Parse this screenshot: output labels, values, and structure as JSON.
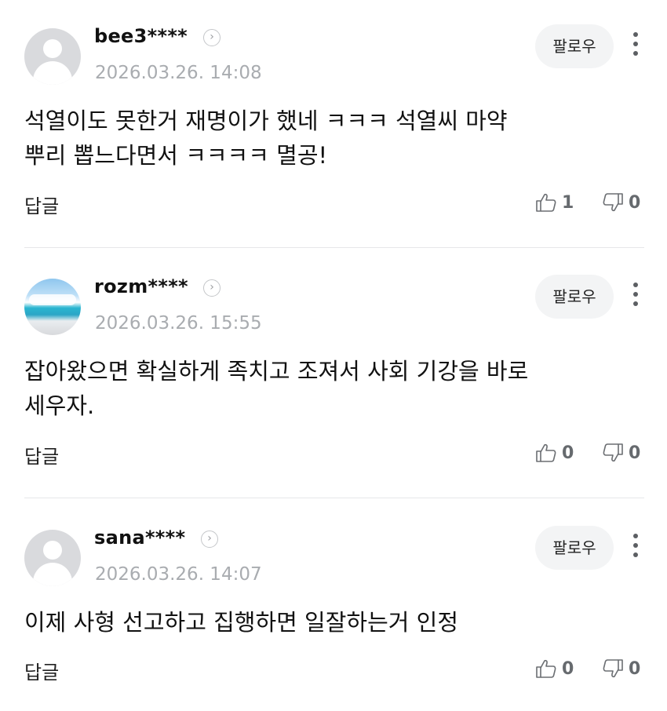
{
  "comments": [
    {
      "username": "bee3****",
      "timestamp": "2026.03.26. 14:08",
      "follow_label": "팔로우",
      "body_lines": [
        "석열이도 못한거 재명이가 했네 ㅋㅋㅋ 석열씨 마약",
        "뿌리 뽑느다면서 ㅋㅋㅋㅋ 멸공!"
      ],
      "reply_label": "답글",
      "likes": "1",
      "dislikes": "0",
      "avatar": "default-avatar"
    },
    {
      "username": "rozm****",
      "timestamp": "2026.03.26. 15:55",
      "follow_label": "팔로우",
      "body_lines": [
        "잡아왔으면 확실하게 족치고 조져서 사회 기강을 바로",
        "세우자."
      ],
      "reply_label": "답글",
      "likes": "0",
      "dislikes": "0",
      "avatar": "beach-photo-avatar"
    },
    {
      "username": "sana****",
      "timestamp": "2026.03.26. 14:07",
      "follow_label": "팔로우",
      "body_lines": [
        "이제 사형 선고하고 집행하면 일잘하는거 인정"
      ],
      "reply_label": "답글",
      "likes": "0",
      "dislikes": "0",
      "avatar": "default-avatar"
    }
  ],
  "icons": {
    "profile_chevron": "chevron-right-icon",
    "more": "more-vertical-icon",
    "like": "thumbs-up-icon",
    "dislike": "thumbs-down-icon"
  },
  "colors": {
    "timestamp": "#a9acb0",
    "follow_bg": "#f3f4f5",
    "divider": "#e6e7e9",
    "vote_text": "#666a6e"
  }
}
